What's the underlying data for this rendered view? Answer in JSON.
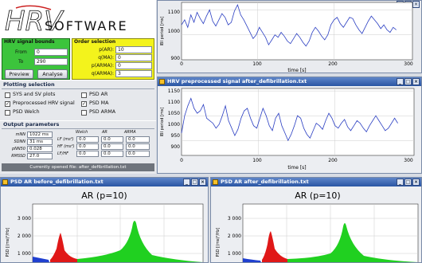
{
  "logo": {
    "letters": "HRV",
    "word": "SOFTWARE"
  },
  "hrv_bounds": {
    "title": "HRV signal bounds",
    "from_label": "From",
    "from_value": "0",
    "to_label": "To",
    "to_value": "290",
    "preview": "Preview",
    "analyse": "Analyse"
  },
  "order": {
    "title": "Order selection",
    "rows": [
      {
        "label": "p(AR):",
        "value": "10"
      },
      {
        "label": "q(MA):",
        "value": "0"
      },
      {
        "label": "p(ARMA):",
        "value": "0"
      },
      {
        "label": "q(ARMA):",
        "value": "3"
      }
    ]
  },
  "plotting": {
    "title": "Plotting selection",
    "items": [
      {
        "label": "SYS and SV plots",
        "checked": false
      },
      {
        "label": "PSD AR",
        "checked": false
      },
      {
        "label": "Preprocessed HRV signal",
        "checked": true
      },
      {
        "label": "PSD MA",
        "checked": true
      },
      {
        "label": "PSD Welch",
        "checked": false
      },
      {
        "label": "PSD ARMA",
        "checked": false
      }
    ]
  },
  "output": {
    "title": "Output parameters",
    "col_heads": [
      "Welch",
      "AR",
      "ARMA"
    ],
    "left_rows": [
      {
        "label": "mNN",
        "value": "1022 ms"
      },
      {
        "label": "SDNN",
        "value": "31 ms"
      },
      {
        "label": "pNN50",
        "value": "0.028"
      },
      {
        "label": "RMSSD",
        "value": "27.0"
      }
    ],
    "right_rows": [
      {
        "label": "LF (ms²)",
        "values": [
          "0.0",
          "0.0",
          "0.0"
        ]
      },
      {
        "label": "HF (ms²)",
        "values": [
          "0.0",
          "0.0",
          "0.0"
        ]
      },
      {
        "label": "LF/HF",
        "values": [
          "0.0",
          "0.0",
          "0.0"
        ]
      }
    ],
    "status": "Currently opened file: after_defibrillation.txt"
  },
  "top_plot": {
    "yticks": [
      "1100",
      "1000",
      "900"
    ],
    "xticks": [
      "0",
      "100",
      "200",
      "300"
    ],
    "xlabel": "time [s]",
    "ylabel": "IBI period [ms]"
  },
  "mid_window": {
    "title": "HRV preprocessed signal after_defibrillation.txt",
    "yticks": [
      "1150",
      "1100",
      "1050",
      "1000",
      "950",
      "900"
    ],
    "xticks": [
      "0",
      "100",
      "200",
      "300"
    ],
    "xlabel": "time [s]",
    "ylabel": "IBI period [ms]"
  },
  "psd_left": {
    "window_title": "PSD AR before_defibrillation.txt",
    "plot_title": "AR (p=10)",
    "yticks": [
      "3 000",
      "2 000",
      "1 000"
    ],
    "ylabel": "PSD [(ms)²/Hz]"
  },
  "psd_right": {
    "window_title": "PSD AR after_defibrillation.txt",
    "plot_title": "AR (p=10)",
    "yticks": [
      "3 000",
      "2 000",
      "1 000"
    ],
    "ylabel": "PSD [(ms)²/Hz]"
  },
  "colors": {
    "titlebar": "#2a55a3",
    "bounds_bg": "#3cc43c",
    "order_bg": "#f3f31c",
    "signal": "#2a3ec2",
    "vlf": "#1f3fd0",
    "lf": "#e01818",
    "hf": "#20d020"
  },
  "signals": {
    "top_series": [
      1040,
      1060,
      1030,
      1080,
      1050,
      1090,
      1065,
      1045,
      1075,
      1100,
      1055,
      1035,
      1060,
      1085,
      1070,
      1040,
      1050,
      1095,
      1120,
      1080,
      1060,
      1035,
      1010,
      985,
      1000,
      1030,
      1010,
      990,
      960,
      980,
      1000,
      990,
      1010,
      995,
      975,
      965,
      985,
      1005,
      990,
      970,
      955,
      975,
      1010,
      1030,
      1015,
      995,
      980,
      1000,
      1040,
      1060,
      1070,
      1045,
      1030,
      1050,
      1070,
      1065,
      1040,
      1020,
      1005,
      1030,
      1055,
      1075,
      1060,
      1045,
      1025,
      1040,
      1020,
      1010,
      1030,
      1020
    ],
    "mid_series": [
      980,
      1050,
      1090,
      1120,
      1080,
      1060,
      1070,
      1095,
      1040,
      1030,
      1020,
      1000,
      1015,
      1050,
      1090,
      1030,
      1000,
      970,
      995,
      1040,
      1070,
      1080,
      1040,
      1010,
      1000,
      1040,
      1080,
      1050,
      1010,
      990,
      1040,
      1060,
      1010,
      980,
      950,
      975,
      1010,
      1050,
      1040,
      1000,
      975,
      960,
      990,
      1020,
      1010,
      995,
      1030,
      1060,
      1040,
      1010,
      1000,
      1020,
      1035,
      1005,
      990,
      1010,
      1030,
      1020,
      1000,
      985,
      1010,
      1030,
      1050,
      1030,
      1010,
      990,
      1000,
      1020,
      1040,
      1020
    ]
  }
}
